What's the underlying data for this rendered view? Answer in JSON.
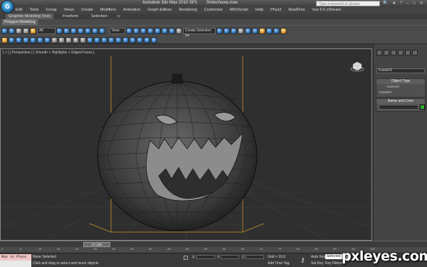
{
  "titlebar": {
    "app_title": "Autodesk 3ds Max 2010 SP1",
    "file_name": "Smiechowa.max",
    "search_placeholder": "Type a keyword or phrase"
  },
  "menu": [
    "Edit",
    "Tools",
    "Group",
    "Views",
    "Create",
    "Modifiers",
    "Animation",
    "Graph Editors",
    "Rendering",
    "Customize",
    "MAXScript",
    "Help",
    "Phys2",
    "RealFlow",
    "Vue 6.5 xStream"
  ],
  "ribbon": {
    "tabs": [
      "Graphite Modeling Tools",
      "Freeform",
      "Selection"
    ],
    "panel_label": "Polygon Modeling"
  },
  "toolbar": {
    "selection_filter": "All",
    "ref_coord": "View",
    "named_selection": "Create Selection Se"
  },
  "viewport": {
    "label": "[ + ] [ Perspective ] [ Smooth + Highlights + Edged Faces ]"
  },
  "command_panel": {
    "category_dropdown": "FumeFX",
    "object_type_header": "Object Type",
    "autogrid_label": "AutoGrid",
    "furfx_button": "FumeFX",
    "name_color_header": "Name and Color",
    "object_color": "#2db52d"
  },
  "timeline": {
    "slider_label": "0 / 100",
    "ruler_ticks": [
      "0",
      "5",
      "10",
      "15",
      "20",
      "25",
      "30",
      "35",
      "40",
      "45",
      "50",
      "55",
      "60",
      "65",
      "70",
      "75",
      "80",
      "85",
      "90",
      "95",
      "100"
    ]
  },
  "status": {
    "maxscript_line1": "Max to Physc",
    "maxscript_line2": "",
    "selection_text": "None Selected",
    "hint_text": "Click and drag to select and move objects",
    "x_label": "X:",
    "y_label": "Y:",
    "z_label": "Z:",
    "grid_text": "Grid = 10,0",
    "add_time_tag": "Add Time Tag",
    "auto_key": "Auto Key",
    "auto_key_value": "Selected",
    "set_key": "Set Key",
    "key_filters": "Key Filters..."
  },
  "watermark": "pxleyes.com"
}
